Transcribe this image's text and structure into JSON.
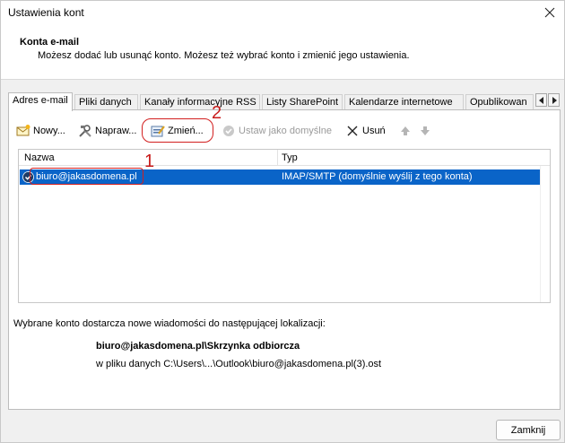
{
  "window": {
    "title": "Ustawienia kont"
  },
  "header": {
    "title": "Konta e-mail",
    "description": "Możesz dodać lub usunąć konto. Możesz też wybrać konto i zmienić jego ustawienia."
  },
  "tabs": [
    {
      "label": "Adres e-mail",
      "active": true
    },
    {
      "label": "Pliki danych"
    },
    {
      "label": "Kanały informacyjne RSS"
    },
    {
      "label": "Listy SharePoint"
    },
    {
      "label": "Kalendarze internetowe"
    },
    {
      "label": "Opublikowan"
    }
  ],
  "toolbar": {
    "new_label": "Nowy...",
    "repair_label": "Napraw...",
    "change_label": "Zmień...",
    "default_label": "Ustaw jako domyślne",
    "remove_label": "Usuń"
  },
  "list": {
    "columns": [
      "Nazwa",
      "Typ"
    ],
    "rows": [
      {
        "name": "biuro@jakasdomena.pl",
        "type": "IMAP/SMTP (domyślnie wyślij z tego konta)"
      }
    ]
  },
  "info": {
    "line": "Wybrane konto dostarcza nowe wiadomości do następującej lokalizacji:",
    "path": "biuro@jakasdomena.pl\\Skrzynka odbiorcza",
    "file": "w pliku danych C:\\Users\\...\\Outlook\\biuro@jakasdomena.pl(3).ost"
  },
  "footer": {
    "close_label": "Zamknij"
  },
  "annotations": {
    "one": "1",
    "two": "2"
  },
  "colors": {
    "selection": "#0a64c8",
    "annotation": "#d21f1f"
  }
}
